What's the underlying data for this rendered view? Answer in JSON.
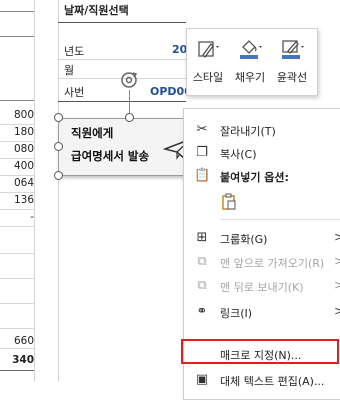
{
  "sheet": {
    "left_numbers": [
      "800",
      "180",
      "080",
      "400",
      "064",
      "136",
      "-",
      "660",
      "340"
    ],
    "right_table": {
      "title": "날짜/직원선택",
      "rows": [
        {
          "label": "년도",
          "value": "20"
        },
        {
          "label": "월",
          "value": ""
        },
        {
          "label": "사번",
          "value": "OPD00"
        }
      ]
    }
  },
  "shape": {
    "line1": "직원에게",
    "line2": "급여명세서 발송"
  },
  "mini_toolbar": {
    "items": [
      {
        "label": "스타일",
        "icon": "shape-style-icon"
      },
      {
        "label": "채우기",
        "icon": "fill-bucket-icon"
      },
      {
        "label": "윤곽선",
        "icon": "outline-pen-icon"
      }
    ]
  },
  "context_menu": {
    "items": [
      {
        "label": "잘라내기(T)",
        "icon": "scissors-icon",
        "disabled": false,
        "submenu": false
      },
      {
        "label": "복사(C)",
        "icon": "copy-icon",
        "disabled": false,
        "submenu": false
      },
      {
        "label": "붙여넣기 옵션:",
        "icon": "paste-icon",
        "disabled": false,
        "submenu": false
      },
      {
        "label": "그룹화(G)",
        "icon": "group-icon",
        "disabled": false,
        "submenu": true
      },
      {
        "label": "맨 앞으로 가져오기(R)",
        "icon": "bring-front-icon",
        "disabled": true,
        "submenu": true
      },
      {
        "label": "맨 뒤로 보내기(K)",
        "icon": "send-back-icon",
        "disabled": true,
        "submenu": true
      },
      {
        "label": "링크(I)",
        "icon": "link-icon",
        "disabled": false,
        "submenu": true
      },
      {
        "label": "매크로 지정(N)...",
        "icon": "",
        "disabled": false,
        "submenu": false
      },
      {
        "label": "대체 텍스트 편집(A)...",
        "icon": "alt-text-icon",
        "disabled": false,
        "submenu": false
      }
    ]
  },
  "colors": {
    "highlight": "#e02020",
    "value_blue": "#1f4e9c"
  }
}
